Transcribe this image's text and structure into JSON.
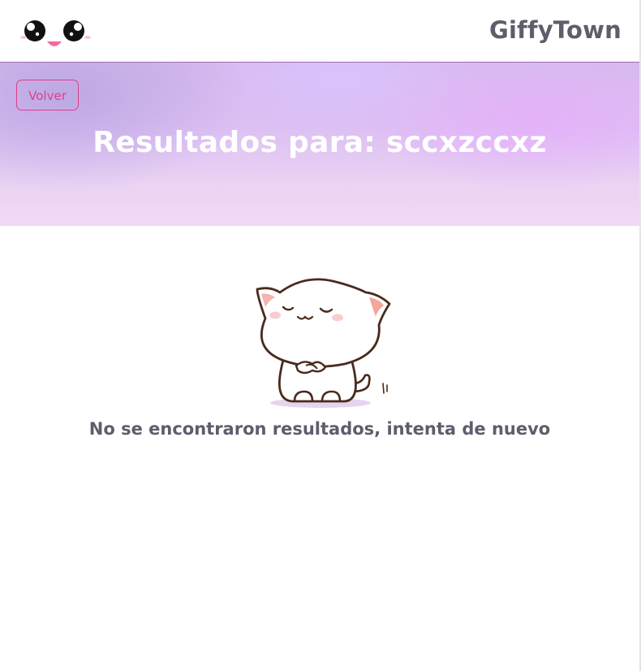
{
  "header": {
    "brand": "GiffyTown",
    "logo_icon": "kawaii-face-icon"
  },
  "hero": {
    "back_label": "Volver",
    "title": "Resultados para: sccxzccxz"
  },
  "empty_state": {
    "illustration_icon": "sleepy-cat-icon",
    "message": "No se encontraron resultados, intenta de nuevo"
  },
  "colors": {
    "accent": "#dc3f88",
    "text": "#5d5d6c",
    "hero_gradient_top": "#d6b9ee",
    "hero_gradient_bottom": "#f1d8f6"
  }
}
